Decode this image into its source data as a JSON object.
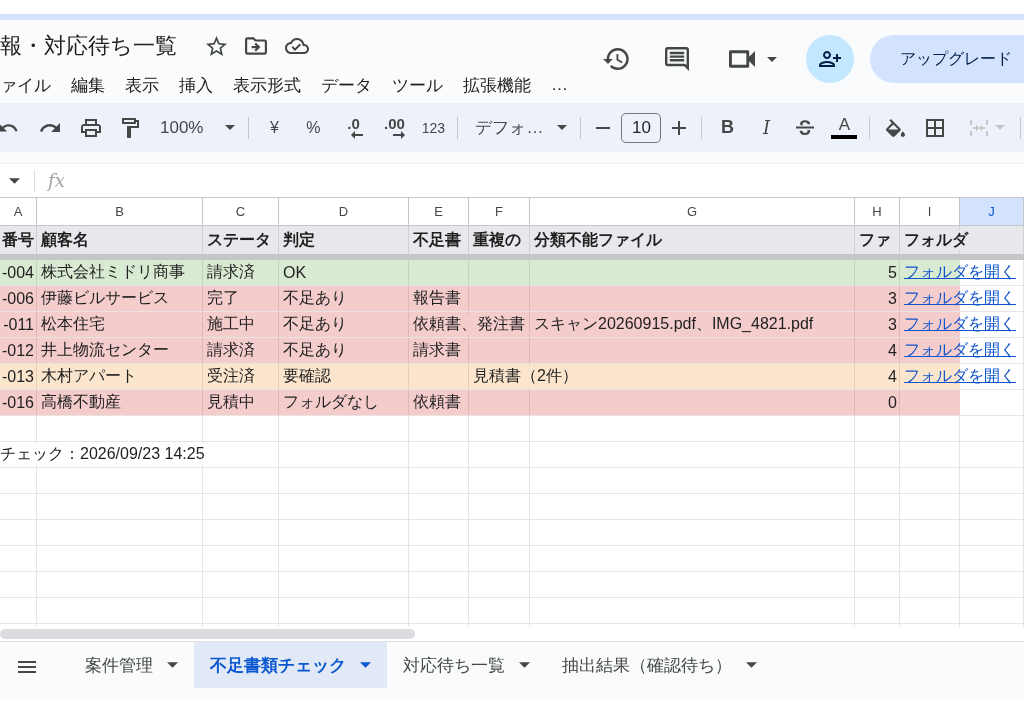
{
  "document": {
    "title": "報・対応待ち一覧",
    "menu": [
      "ァイル",
      "編集",
      "表示",
      "挿入",
      "表示形式",
      "データ",
      "ツール",
      "拡張機能",
      "…"
    ],
    "upgrade_button": "アップグレード"
  },
  "toolbar": {
    "zoom": "100%",
    "currency": "¥",
    "percent": "%",
    "decrease_decimal": ".0",
    "increase_decimal": ".00",
    "number_format": "123",
    "font": "デフォ…",
    "font_size": "10",
    "bold": "B",
    "italic": "I",
    "text_color": "A"
  },
  "formula_bar": {
    "label": "fx"
  },
  "table": {
    "columns": [
      {
        "label": "A",
        "selected": false
      },
      {
        "label": "B",
        "selected": false
      },
      {
        "label": "C",
        "selected": false
      },
      {
        "label": "D",
        "selected": false
      },
      {
        "label": "E",
        "selected": false
      },
      {
        "label": "F",
        "selected": false
      },
      {
        "label": "G",
        "selected": false
      },
      {
        "label": "H",
        "selected": false
      },
      {
        "label": "I",
        "selected": false
      },
      {
        "label": "J",
        "selected": true
      }
    ],
    "header": [
      "番号",
      "顧客名",
      "ステータ",
      "判定",
      "不足書",
      "重複の",
      "分類不能ファイル",
      "ファ",
      "フォルダ"
    ],
    "rows": [
      {
        "color": "#d9ead3",
        "a": "-004",
        "b": "株式会社ミドリ商事",
        "c": "請求済",
        "d": "OK",
        "h": "5",
        "i": "フォルダを開く"
      },
      {
        "color": "#f4cccc",
        "a": "-006",
        "b": "伊藤ビルサービス",
        "c": "完了",
        "d": "不足あり",
        "e": "報告書",
        "h": "3",
        "i": "フォルダを開く"
      },
      {
        "color": "#f4cccc",
        "a": "-011",
        "b": "松本住宅",
        "c": "施工中",
        "d": "不足あり",
        "e": "依頼書、発注書",
        "g": "スキャン20260915.pdf、IMG_4821.pdf",
        "h": "3",
        "i": "フォルダを開く"
      },
      {
        "color": "#f4cccc",
        "a": "-012",
        "b": "井上物流センター",
        "c": "請求済",
        "d": "不足あり",
        "e": "請求書",
        "h": "4",
        "i": "フォルダを開く"
      },
      {
        "color": "#fce5cd",
        "a": "-013",
        "b": "木村アパート",
        "c": "受注済",
        "d": "要確認",
        "f": "見積書（2件）",
        "h": "4",
        "i": "フォルダを開く"
      },
      {
        "color": "#f4cccc",
        "a": "-016",
        "b": "高橋不動産",
        "c": "見積中",
        "d": "フォルダなし",
        "e": "依頼書",
        "h": "0"
      }
    ],
    "note": "チェック：2026/09/23 14:25"
  },
  "sheet_tabs": [
    {
      "label": "案件管理",
      "selected": false
    },
    {
      "label": "不足書類チェック",
      "selected": true
    },
    {
      "label": "対応待ち一覧",
      "selected": false
    },
    {
      "label": "抽出結果（確認待ち）",
      "selected": false
    }
  ]
}
